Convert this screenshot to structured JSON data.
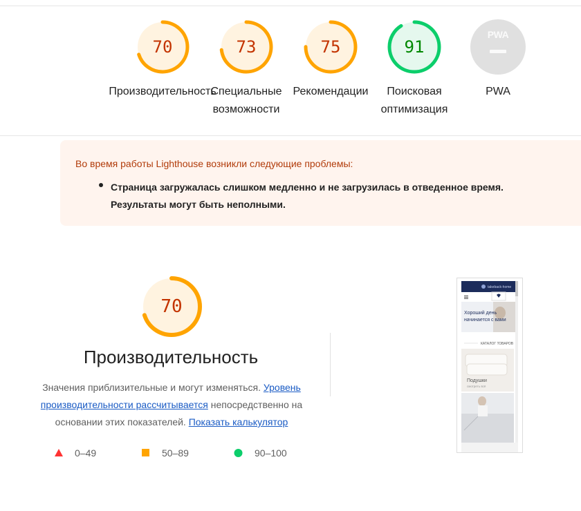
{
  "colors": {
    "average": "#ffa400",
    "average_text": "#c33300",
    "average_bg": "#fff3e0",
    "pass": "#0cce6b",
    "pass_text": "#008800",
    "pass_bg": "#e5f8ee",
    "fail": "#ff3333",
    "na": "#e0e0e0",
    "warning_bg": "#fff4ee",
    "warning_text": "#b13b0a",
    "link": "#1a5bc4"
  },
  "gauges": [
    {
      "score": "70",
      "label_lines": [
        "Производительность"
      ],
      "rating": "average",
      "fraction": 0.7
    },
    {
      "score": "73",
      "label_lines": [
        "Специальные",
        "возможности"
      ],
      "rating": "average",
      "fraction": 0.73
    },
    {
      "score": "75",
      "label_lines": [
        "Рекомендации"
      ],
      "rating": "average",
      "fraction": 0.75
    },
    {
      "score": "91",
      "label_lines": [
        "Поисковая",
        "оптимизация"
      ],
      "rating": "pass",
      "fraction": 0.91
    }
  ],
  "pwa": {
    "badge_text": "PWA",
    "label": "PWA"
  },
  "warning": {
    "heading": "Во время работы Lighthouse возникли следующие проблемы:",
    "items": [
      "Страница загружалась слишком медленно и не загрузилась в отведенное время. Результаты могут быть неполными."
    ]
  },
  "performance": {
    "score": "70",
    "fraction": 0.7,
    "title": "Производительность",
    "desc_before": "Значения приблизительные и могут изменяться. ",
    "desc_link1": "Уровень производительности рассчитывается",
    "desc_middle": " непосредственно на основании этих показателей. ",
    "desc_link2": "Показать калькулятор"
  },
  "legend": [
    {
      "range": "0–49",
      "shape": "triangle",
      "color": "#ff3333"
    },
    {
      "range": "50–89",
      "shape": "square",
      "color": "#ffa400"
    },
    {
      "range": "90–100",
      "shape": "circle",
      "color": "#0cce6b"
    }
  ],
  "screenshot": {
    "site_name": "takeback-home",
    "hero_text": "Хороший день начинается с вами",
    "catalog_label": "КАТАЛОГ ТОВАРОВ",
    "card_title": "Подушки",
    "card_link": "смотреть всё"
  }
}
